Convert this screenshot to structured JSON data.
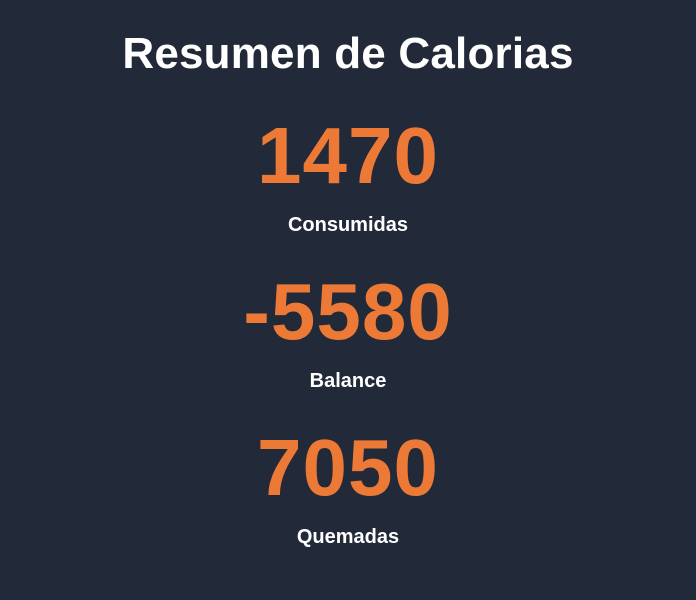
{
  "summary": {
    "title": "Resumen de Calorias",
    "metrics": [
      {
        "value": "1470",
        "label": "Consumidas"
      },
      {
        "value": "-5580",
        "label": "Balance"
      },
      {
        "value": "7050",
        "label": "Quemadas"
      }
    ]
  },
  "colors": {
    "background": "#222938",
    "accent": "#ec7935",
    "text": "#ffffff"
  }
}
